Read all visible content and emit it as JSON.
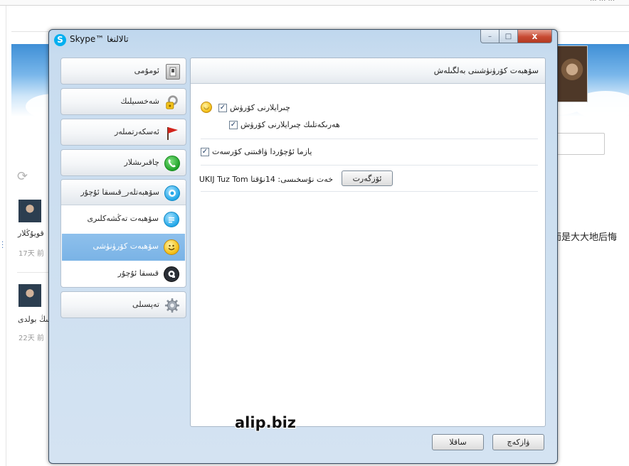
{
  "window": {
    "title": "Skype™ تالالنغا",
    "controls": {
      "minimize": "–",
      "maximize": "□",
      "close": "x"
    }
  },
  "sidebar": {
    "items": [
      {
        "label": "ئومۇمى",
        "icon": "switch-icon"
      },
      {
        "label": "شەخسىيلىك",
        "icon": "keys-lock-icon"
      },
      {
        "label": "ئەسكەرتمىلەر",
        "icon": "flag-icon"
      },
      {
        "label": "چاقىرىشلار",
        "icon": "phone-icon"
      }
    ],
    "group": {
      "label": "سۆھبەتلەر_قىسقا ئۇچۇر",
      "icon": "chat-bubble-icon",
      "subitems": [
        {
          "label": "سۆھبەت تەڭشەكلىرى",
          "icon": "chat-settings-icon"
        },
        {
          "label": "سۆھبەت كۆرۈنۈشى",
          "icon": "smiley-icon",
          "selected": true
        },
        {
          "label": "قىسقا ئۇچۇر",
          "icon": "sms-icon"
        }
      ]
    },
    "advanced": {
      "label": "تەپسىلى",
      "icon": "gear-icon"
    }
  },
  "panel": {
    "title": "سۆھبەت كۆرۈنۈشىنى بەلگىلەش",
    "options": [
      {
        "label": "چىرايلارنى كۆرۈش",
        "checked": true
      },
      {
        "label": "ھەرىكەتلىك چىرايلارنى كۆرۈش",
        "checked": true
      },
      {
        "label": "يازما ئۇچۇردا ۋاقىتنى كۆرسەت",
        "checked": true
      }
    ],
    "checkmark": "✓",
    "smiley": "◡",
    "font_label": "خەت نۇسخىسى: 14نۇقتا UKIJ Tuz Tom",
    "change_font_button": "ئۆزگەرت"
  },
  "footer": {
    "save_button": "ساقلا",
    "cancel_button": "ۋازكەچ"
  },
  "watermark": "alip.biz",
  "background": {
    "top_fragment": "... ... ...",
    "refresh_glyph": "⟳",
    "posts": [
      {
        "text": "قويۇڭلار",
        "time": "17天 前"
      },
      {
        "text": "يىڭ بولدى",
        "time": "22天 前"
      }
    ],
    "right_text": "而是大大地后悔"
  }
}
